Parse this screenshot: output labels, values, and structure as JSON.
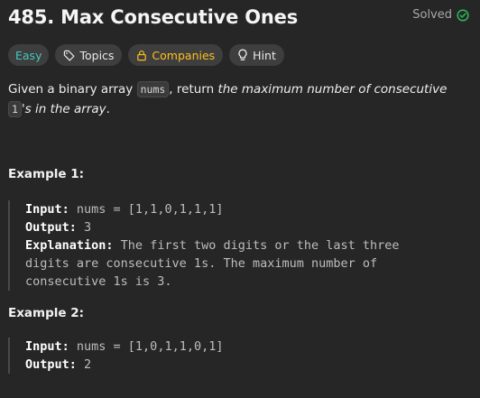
{
  "header": {
    "title": "485. Max Consecutive Ones",
    "status": "Solved"
  },
  "tags": {
    "difficulty": "Easy",
    "topics": "Topics",
    "companies": "Companies",
    "hint": "Hint"
  },
  "colors": {
    "background": "#262626",
    "easy": "#46c6c2",
    "companies": "#ffc01e",
    "solved_check": "#2cbb5d",
    "tag_bg": "#3e3e3e"
  },
  "description": {
    "part1": "Given a binary array ",
    "code1": "nums",
    "part2": ", return ",
    "emph1": "the maximum number of consecutive ",
    "code2": "1",
    "emph2": "'s in the array",
    "end": "."
  },
  "examples": [
    {
      "title": "Example 1:",
      "input_label": "Input:",
      "input_value": " nums = [1,1,0,1,1,1]",
      "output_label": "Output:",
      "output_value": " 3",
      "explanation_label": "Explanation:",
      "explanation_l1": " The first two digits or the last three",
      "explanation_l2": "digits are consecutive 1s. The maximum number of",
      "explanation_l3": "consecutive 1s is 3."
    },
    {
      "title": "Example 2:",
      "input_label": "Input:",
      "input_value": " nums = [1,0,1,1,0,1]",
      "output_label": "Output:",
      "output_value": " 2"
    }
  ]
}
